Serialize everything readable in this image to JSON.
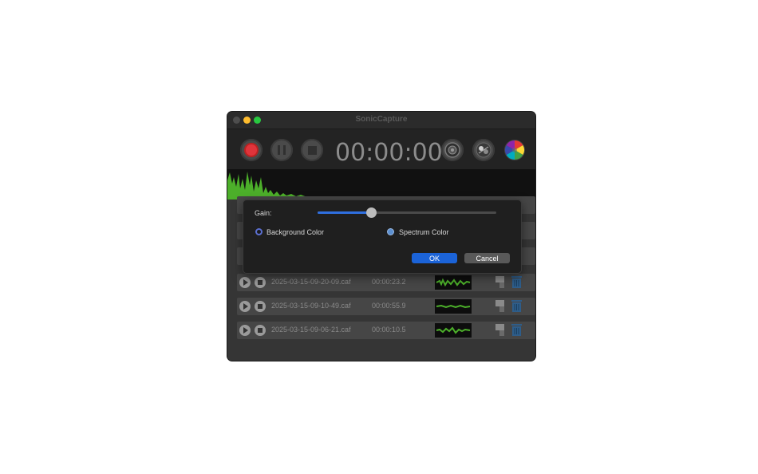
{
  "window": {
    "title": "SonicCapture"
  },
  "toolbar": {
    "timer": "00:00:00",
    "buttons": [
      {
        "name": "record-button",
        "icon": "record-icon",
        "color": "#e0343b"
      },
      {
        "name": "pause-button",
        "icon": "pause-icon"
      },
      {
        "name": "stop-button",
        "icon": "stop-icon"
      },
      {
        "name": "speaker-button",
        "icon": "speaker-icon"
      },
      {
        "name": "settings-button",
        "icon": "sliders-icon"
      },
      {
        "name": "color-button",
        "icon": "color-wheel-icon"
      }
    ]
  },
  "recordings": [
    {
      "filename": "2025-03-15-09-20-09.caf",
      "duration": "00:00:23.2"
    },
    {
      "filename": "2025-03-15-09-10-49.caf",
      "duration": "00:00:55.9"
    },
    {
      "filename": "2025-03-15-09-06-21.caf",
      "duration": "00:00:10.5"
    }
  ],
  "dialog": {
    "gain_label": "Gain:",
    "gain_value": 0.3,
    "background_color_label": "Background Color",
    "background_color": "#1a1a1a",
    "spectrum_color_label": "Spectrum Color",
    "spectrum_color": "#5b8fd0",
    "ok_label": "OK",
    "cancel_label": "Cancel"
  },
  "colors": {
    "accent": "#1b63d8",
    "spectrum_green": "#4caf2a"
  }
}
